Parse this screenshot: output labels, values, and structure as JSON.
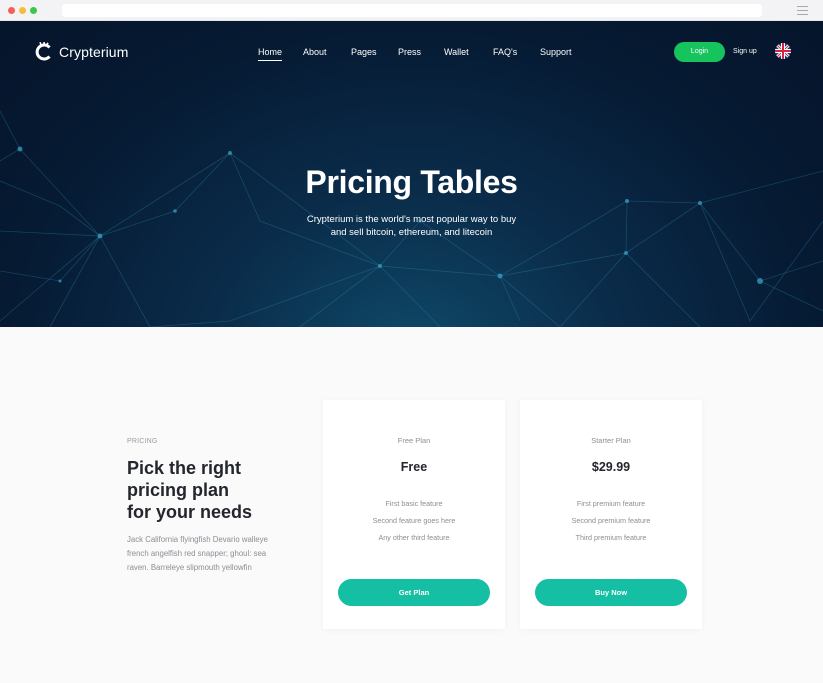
{
  "brand": {
    "name": "Crypterium"
  },
  "nav": {
    "items": [
      "Home",
      "About",
      "Pages",
      "Press",
      "Wallet",
      "FAQ's",
      "Support"
    ],
    "active": "Home"
  },
  "header": {
    "login_label": "Login",
    "signup_label": "Sign up",
    "language_icon": "uk-flag-icon"
  },
  "hero": {
    "title": "Pricing Tables",
    "subtitle_line1": "Crypterium is the world's most popular way to buy",
    "subtitle_line2": "and sell bitcoin, ethereum, and litecoin"
  },
  "pricing_intro": {
    "eyebrow": "PRICING",
    "heading_line1": "Pick the right",
    "heading_line2": "pricing plan",
    "heading_line3": "for your needs",
    "description": "Jack California flyingfish Devario walleye french angelfish red snapper; ghoul: sea raven. Barreleye slipmouth yellowfin"
  },
  "plans": [
    {
      "name": "Free Plan",
      "price": "Free",
      "features": [
        "First basic feature",
        "Second feature goes here",
        "Any other third feature"
      ],
      "button": "Get Plan"
    },
    {
      "name": "Starter Plan",
      "price": "$29.99",
      "features": [
        "First premium feature",
        "Second premium feature",
        "Third premium feature"
      ],
      "button": "Buy Now"
    }
  ],
  "colors": {
    "hero_bg": "#061a33",
    "login_green": "#16c45e",
    "plan_button_teal": "#14bfa3",
    "heading_text": "#23262d",
    "muted_text": "#8b8e95"
  }
}
